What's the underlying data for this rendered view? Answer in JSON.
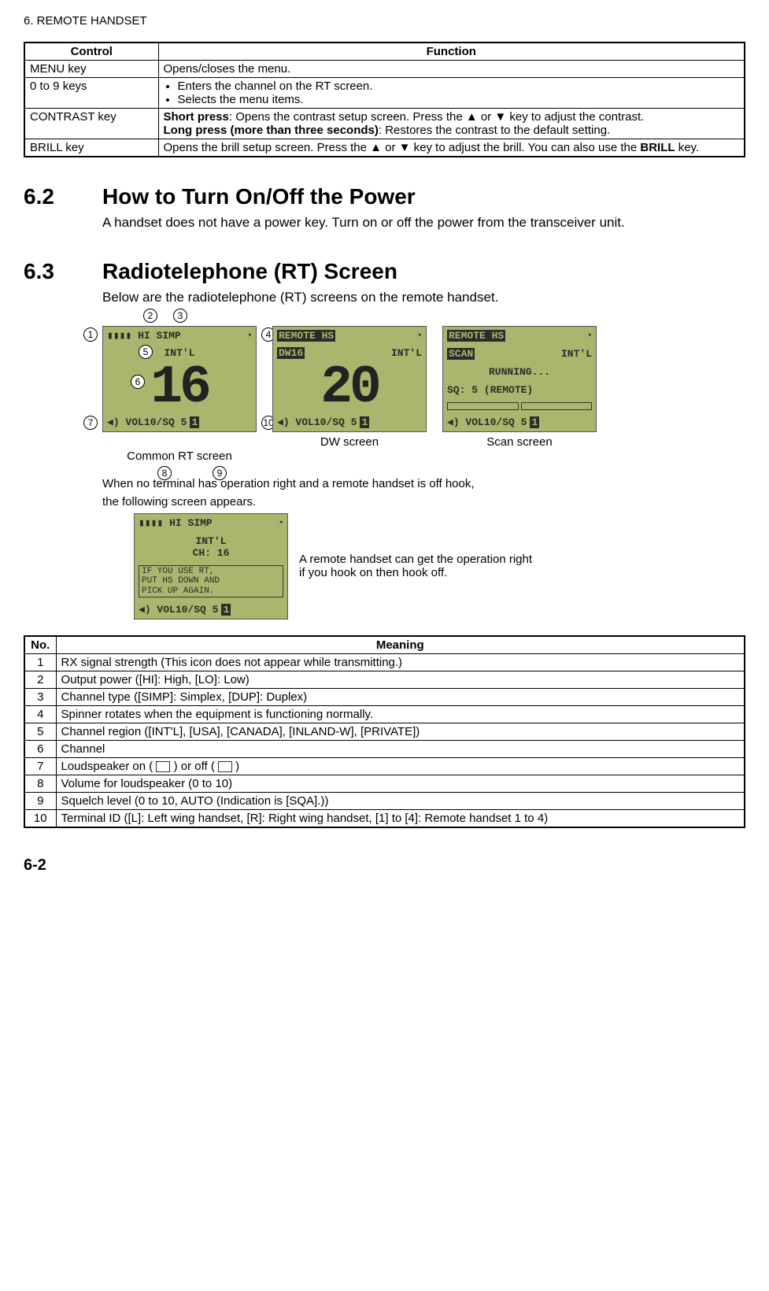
{
  "chapter": "6.  REMOTE HANDSET",
  "controls_table": {
    "headers": {
      "control": "Control",
      "function": "Function"
    },
    "rows": [
      {
        "control": "MENU key",
        "function_plain": "Opens/closes the menu."
      },
      {
        "control": "0 to 9 keys",
        "bullets": [
          "Enters the channel on the RT screen.",
          "Selects the menu items."
        ]
      },
      {
        "control": "CONTRAST key",
        "rich": {
          "short_press_label": "Short press",
          "short_press_text": ": Opens the contrast setup screen. Press the ▲ or ▼ key to adjust the contrast.",
          "long_press_label": "Long press (more than three seconds)",
          "long_press_text": ": Restores the contrast to the default setting."
        }
      },
      {
        "control": "BRILL key",
        "brill": {
          "pre": "Opens the brill setup screen. Press the ▲ or ▼ key to adjust the brill. You can also use the ",
          "key": "BRILL",
          "post": " key."
        }
      }
    ]
  },
  "sections": {
    "power": {
      "num": "6.2",
      "title": "How to Turn On/Off the Power",
      "text": "A handset does not have a power key. Turn on or off the power from the transceiver unit."
    },
    "rt": {
      "num": "6.3",
      "title": "Radiotelephone (RT) Screen",
      "intro": "Below are the radiotelephone (RT) screens on the remote handset."
    }
  },
  "lcd": {
    "common": {
      "top_left": "▮▮▮▮ HI SIMP",
      "top_right": "◔",
      "region": "INT'L",
      "channel": "16",
      "bottom": "◀) VOL10/SQ 5",
      "terminal": "1",
      "caption": "Common RT screen"
    },
    "dw": {
      "top_left": "REMOTE HS",
      "top_right": "◔",
      "row2_left": "DW16",
      "row2_right": "INT'L",
      "channel": "20",
      "bottom": "◀) VOL10/SQ 5",
      "terminal": "1",
      "caption": "DW screen"
    },
    "scan": {
      "top_left": "REMOTE HS",
      "top_right": "◔",
      "row2_left": "SCAN",
      "row2_right": "INT'L",
      "running": "RUNNING...",
      "sq": "SQ: 5  (REMOTE)",
      "bottom": "◀) VOL10/SQ 5",
      "terminal": "1",
      "caption": "Scan screen"
    },
    "offhook_intro_1": "When no terminal has operation right and a remote handset is off hook,",
    "offhook_intro_2": "the following screen appears.",
    "offhook_screen": {
      "top_left": "▮▮▮▮ HI SIMP",
      "top_right": "◔",
      "region": "INT'L",
      "ch": "CH: 16",
      "msg_l1": "IF YOU USE RT,",
      "msg_l2": "PUT HS DOWN AND",
      "msg_l3": "PICK UP AGAIN.",
      "bottom": "◀) VOL10/SQ 5",
      "terminal": "1"
    },
    "offhook_desc": "A remote handset can get the operation right if you hook on then hook off."
  },
  "meaning_table": {
    "headers": {
      "no": "No.",
      "meaning": "Meaning"
    },
    "rows": [
      {
        "no": "1",
        "meaning": "RX signal strength (This icon does not appear while transmitting.)"
      },
      {
        "no": "2",
        "meaning": "Output power ([HI]: High, [LO]: Low)"
      },
      {
        "no": "3",
        "meaning": "Channel type ([SIMP]: Simplex, [DUP]: Duplex)"
      },
      {
        "no": "4",
        "meaning": "Spinner rotates when the equipment is functioning normally."
      },
      {
        "no": "5",
        "meaning": "Channel region ([INT'L], [USA], [CANADA], [INLAND-W], [PRIVATE])"
      },
      {
        "no": "6",
        "meaning": "Channel"
      },
      {
        "no": "7",
        "meaning_speaker": {
          "pre": "Loudspeaker on ( ",
          "mid": " ) or off ( ",
          "post": " )"
        }
      },
      {
        "no": "8",
        "meaning": "Volume for loudspeaker (0 to 10)"
      },
      {
        "no": "9",
        "meaning": "Squelch level (0 to 10, AUTO (Indication is [SQA].))"
      },
      {
        "no": "10",
        "meaning": "Terminal ID ([L]: Left wing handset, [R]: Right wing handset, [1] to [4]: Remote handset 1 to 4)"
      }
    ]
  },
  "callouts": {
    "c1": "1",
    "c2": "2",
    "c3": "3",
    "c4": "4",
    "c5": "5",
    "c6": "6",
    "c7": "7",
    "c8": "8",
    "c9": "9",
    "c10": "10"
  },
  "page": "6-2"
}
